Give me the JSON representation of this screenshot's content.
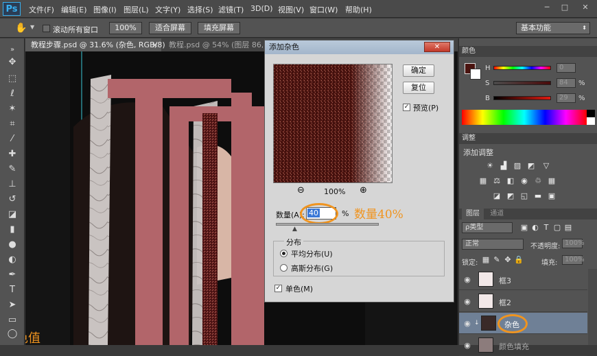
{
  "app": {
    "logo": "Ps"
  },
  "menu": [
    "文件(F)",
    "编辑(E)",
    "图像(I)",
    "图层(L)",
    "文字(Y)",
    "选择(S)",
    "滤镜(T)",
    "3D(D)",
    "视图(V)",
    "窗口(W)",
    "帮助(H)"
  ],
  "window_controls": {
    "minimize": "─",
    "restore": "□",
    "close": "✕"
  },
  "options": {
    "scroll_all": "滚动所有窗口",
    "zoom_100": "100%",
    "fit_screen": "适合屏幕",
    "fill_screen": "填充屏幕",
    "workspace": "基本功能"
  },
  "doc_tabs": [
    {
      "label": "教程步骤.psd @ 31.6% (杂色, RGB/8)",
      "close": "×"
    },
    {
      "label": "教程.psd @ 54% (图层 86, RG",
      "close": ""
    }
  ],
  "dialog": {
    "title": "添加杂色",
    "close": "✕",
    "ok": "确定",
    "reset": "复位",
    "preview_label": "预览(P)",
    "preview_checked": "✓",
    "zoom_out": "⊖",
    "zoom_level": "100%",
    "zoom_in": "⊕",
    "amount_label": "数量(A):",
    "amount_value": "40",
    "amount_unit": "%",
    "annotation": "数量40%",
    "distribution_label": "分布",
    "uniform": "平均分布(U)",
    "gaussian": "高斯分布(G)",
    "mono": "单色(M)",
    "mono_checked": "✓"
  },
  "color_panel": {
    "title": "颜色",
    "h": "H",
    "s": "S",
    "b": "B",
    "h_val": "0",
    "s_val": "84",
    "b_val": "29",
    "h_unit": "",
    "s_unit": "%",
    "b_unit": "%"
  },
  "adjust_panel": {
    "title": "调整",
    "subtitle": "添加调整"
  },
  "layers_panel": {
    "tab_layers": "图层",
    "tab_channels": "通道",
    "kind": "ρ类型",
    "blend": "正常",
    "opacity_label": "不透明度:",
    "opacity_val": "100%",
    "lock_label": "锁定:",
    "fill_label": "填充:",
    "fill_val": "100%",
    "layers": [
      {
        "name": "框3"
      },
      {
        "name": "框2"
      },
      {
        "name": "杂色"
      },
      {
        "name": "颜色填充"
      }
    ]
  },
  "canvas_caption": "色值",
  "colors": {
    "foreground": "#4a1410",
    "accent_orange": "#f0941f",
    "frame_pink": "#b2656a"
  }
}
